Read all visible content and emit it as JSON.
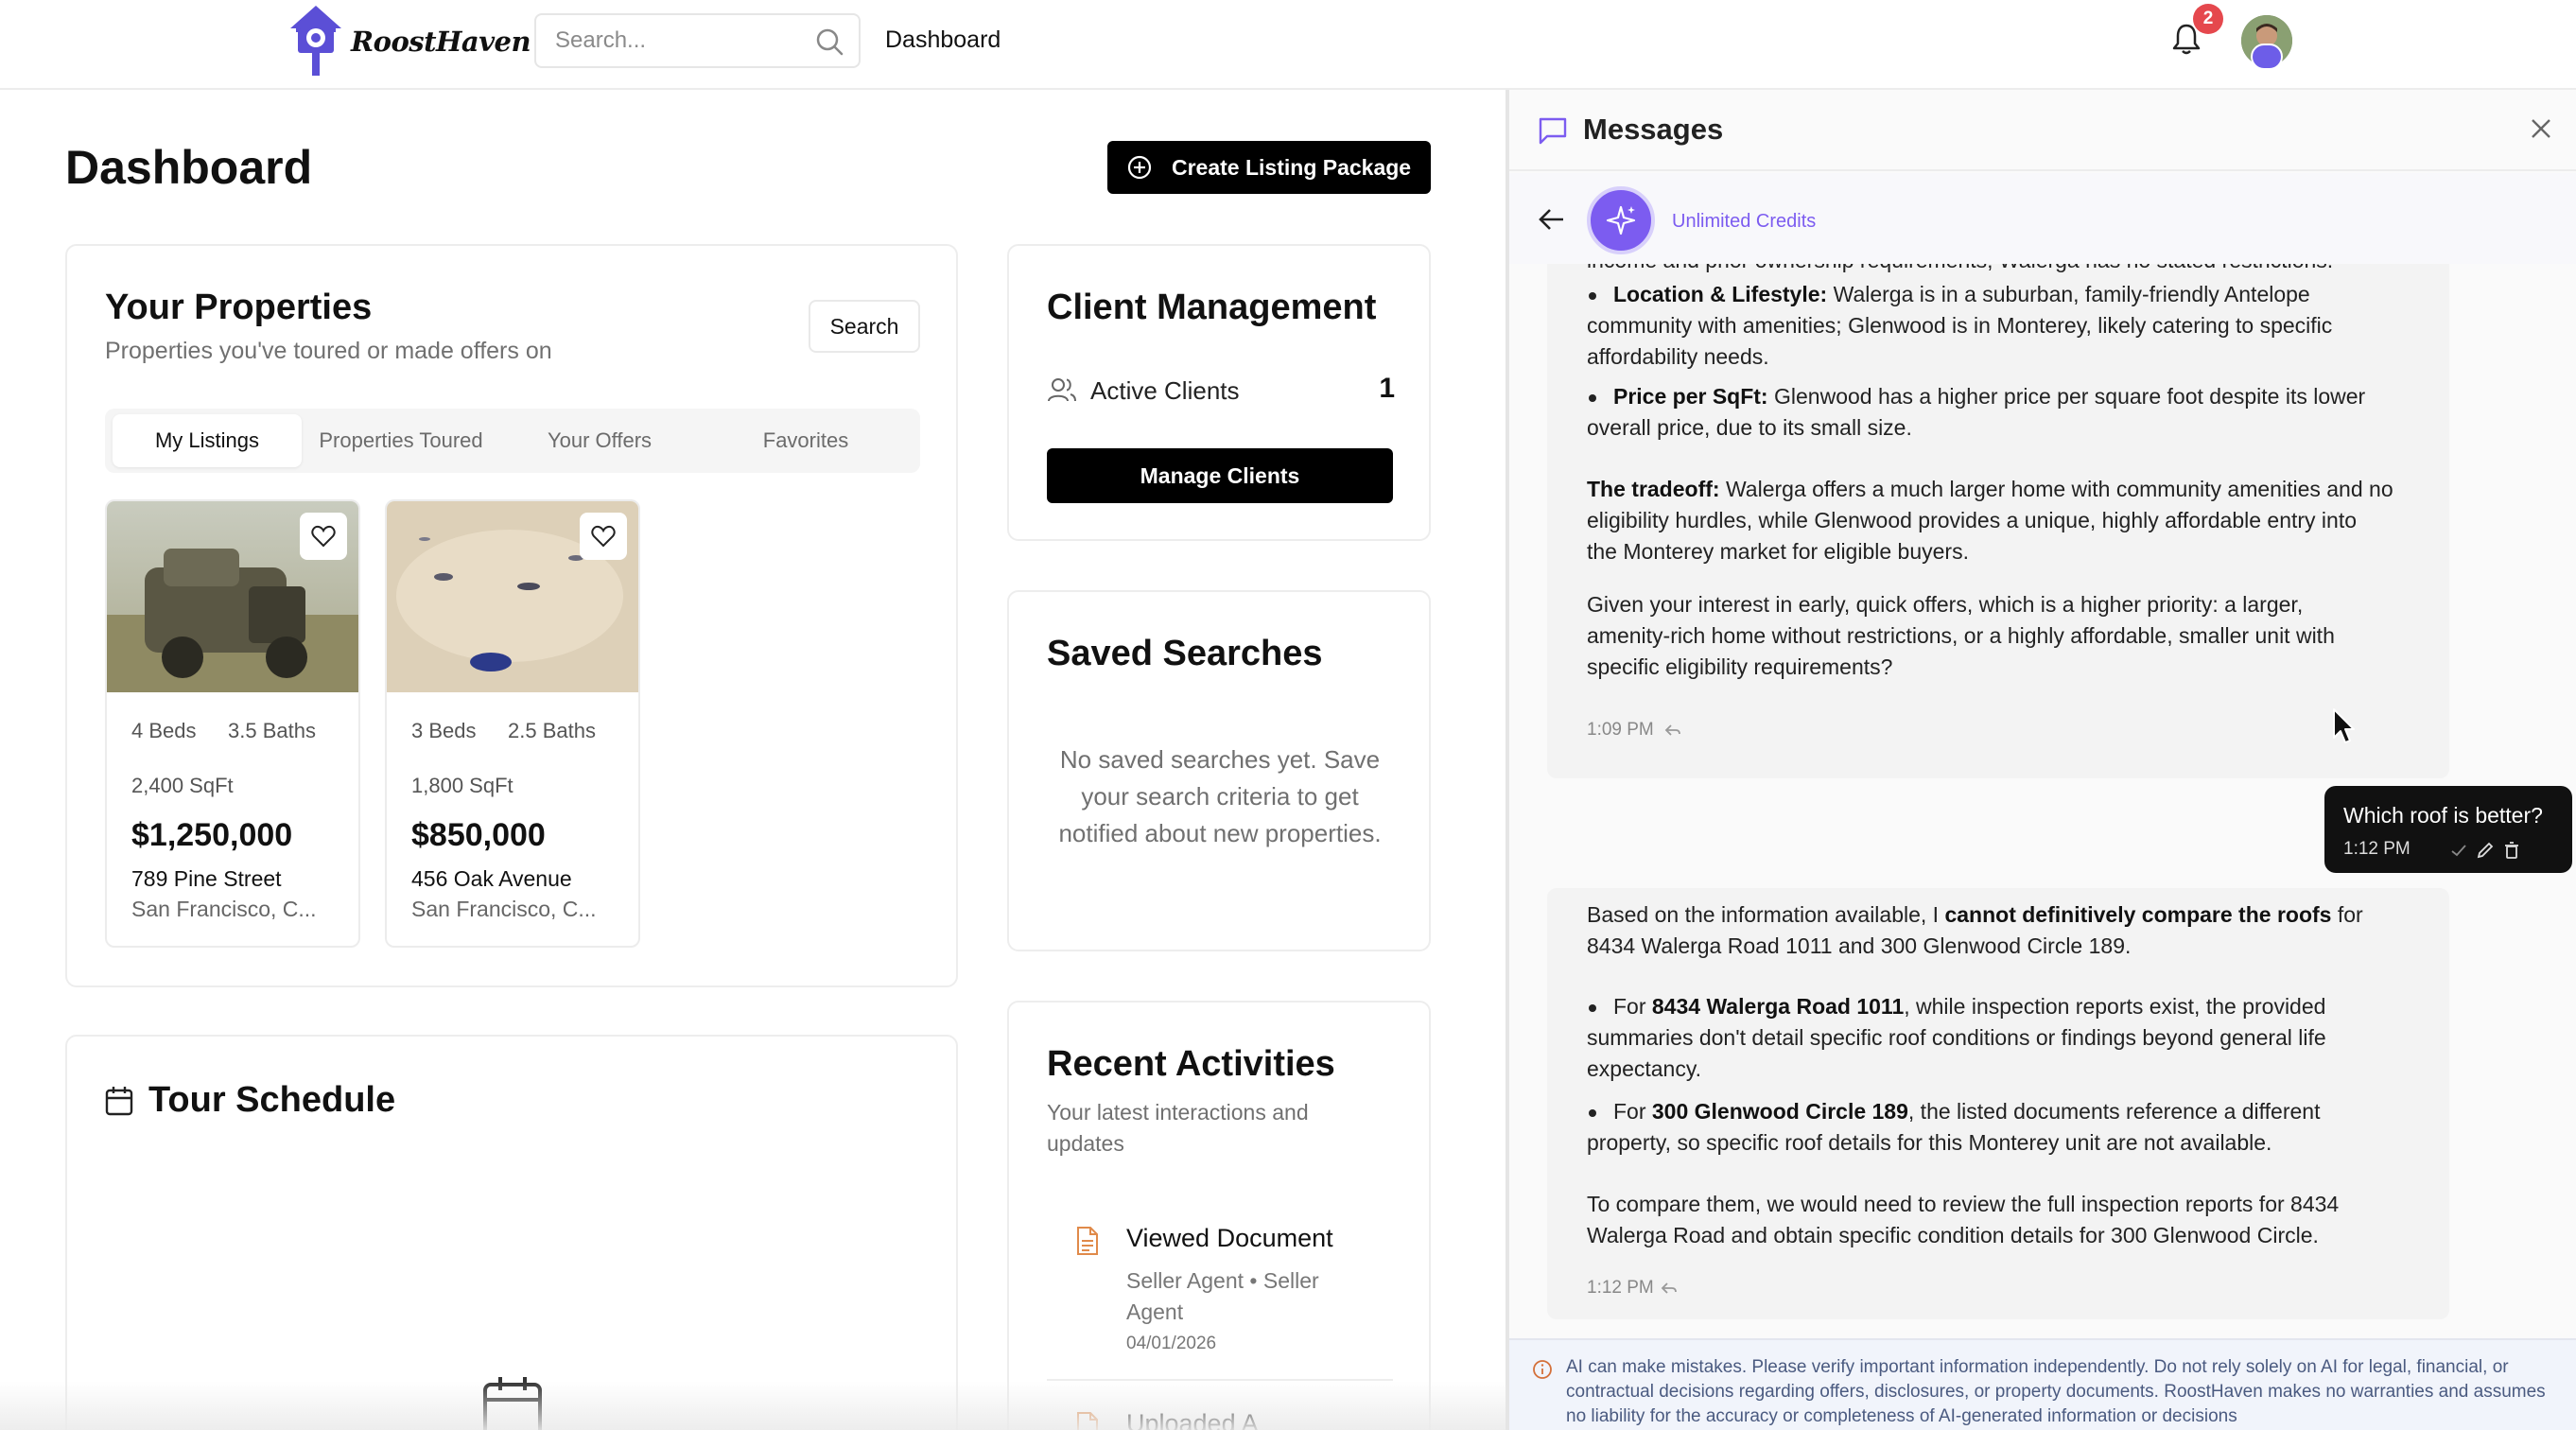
{
  "header": {
    "brand": "RoostHaven",
    "search_placeholder": "Search...",
    "nav_dashboard": "Dashboard",
    "notification_count": "2"
  },
  "page": {
    "title": "Dashboard",
    "create_button": "Create Listing Package"
  },
  "properties": {
    "title": "Your Properties",
    "subtitle": "Properties you've toured or made offers on",
    "search_button": "Search",
    "tabs": [
      "My Listings",
      "Properties Toured",
      "Your Offers",
      "Favorites"
    ],
    "active_tab": "My Listings",
    "listings": [
      {
        "beds": "4 Beds",
        "baths": "3.5 Baths",
        "sqft": "2,400 SqFt",
        "price": "$1,250,000",
        "address": "789 Pine Street",
        "city": "San Francisco, C..."
      },
      {
        "beds": "3 Beds",
        "baths": "2.5 Baths",
        "sqft": "1,800 SqFt",
        "price": "$850,000",
        "address": "456 Oak Avenue",
        "city": "San Francisco, C..."
      }
    ]
  },
  "client_management": {
    "title": "Client Management",
    "active_clients_label": "Active Clients",
    "active_clients_count": "1",
    "manage_button": "Manage Clients"
  },
  "saved_searches": {
    "title": "Saved Searches",
    "empty_text": "No saved searches yet. Save your search criteria to get notified about new properties."
  },
  "tour_schedule": {
    "title": "Tour Schedule"
  },
  "recent_activities": {
    "title": "Recent Activities",
    "subtitle": "Your latest interactions and updates",
    "items": [
      {
        "title": "Viewed Document",
        "meta": "Seller Agent • Seller Agent",
        "date": "04/01/2026"
      },
      {
        "title": "Uploaded A"
      }
    ]
  },
  "messages": {
    "title": "Messages",
    "credits": "Unlimited Credits",
    "msg1": {
      "cut_line": "income and prior ownership requirements; Walerga has no stated restrictions.",
      "b1_label": "Location & Lifestyle:",
      "b1_l1": " Walerga is in a suburban, family-friendly Antelope",
      "b1_l2": "community with amenities; Glenwood is in Monterey, likely catering to specific",
      "b1_l3": "affordability needs.",
      "b2_label": "Price per SqFt:",
      "b2_l1": " Glenwood has a higher price per square foot despite its lower",
      "b2_l2": "overall price, due to its small size.",
      "t_label": "The tradeoff:",
      "t_l1": " Walerga offers a much larger home with community amenities and no",
      "t_l2": "eligibility hurdles, while Glenwood provides a unique, highly affordable entry into",
      "t_l3": "the Monterey market for eligible buyers.",
      "q_l1": "Given your interest in early, quick offers, which is a higher priority: a larger,",
      "q_l2": "amenity-rich home without restrictions, or a highly affordable, smaller unit with",
      "q_l3": "specific eligibility requirements?",
      "time": "1:09 PM"
    },
    "user_msg": {
      "text": "Which roof is better?",
      "time": "1:12 PM"
    },
    "msg2": {
      "p1_l1_a": "Based on the information available, I ",
      "p1_l1_b": "cannot definitively compare the roofs",
      "p1_l1_c": " for",
      "p1_l2": "8434 Walerga Road 1011 and 300 Glenwood Circle 189.",
      "b1_label": "8434 Walerga Road 1011",
      "b1_pre": "For ",
      "b1_l1": ", while inspection reports exist, the provided",
      "b1_l2": "summaries don't detail specific roof conditions or findings beyond general life",
      "b1_l3": "expectancy.",
      "b2_pre": "For ",
      "b2_label": "300 Glenwood Circle 189",
      "b2_l1": ", the listed documents reference a different",
      "b2_l2": "property, so specific roof details for this Monterey unit are not available.",
      "c_l1": "To compare them, we would need to review the full inspection reports for 8434",
      "c_l2": "Walerga Road and obtain specific condition details for 300 Glenwood Circle.",
      "time": "1:12 PM"
    },
    "disclaimer": "AI can make mistakes. Please verify important information independently. Do not rely solely on AI for legal, financial, or contractual decisions regarding offers, disclosures, or property documents. RoostHaven makes no warranties and assumes no liability for the accuracy or completeness of AI-generated information or decisions"
  },
  "colors": {
    "accent_purple": "#7c5cf0",
    "badge_red": "#e5484d",
    "primary_black": "#000000"
  }
}
